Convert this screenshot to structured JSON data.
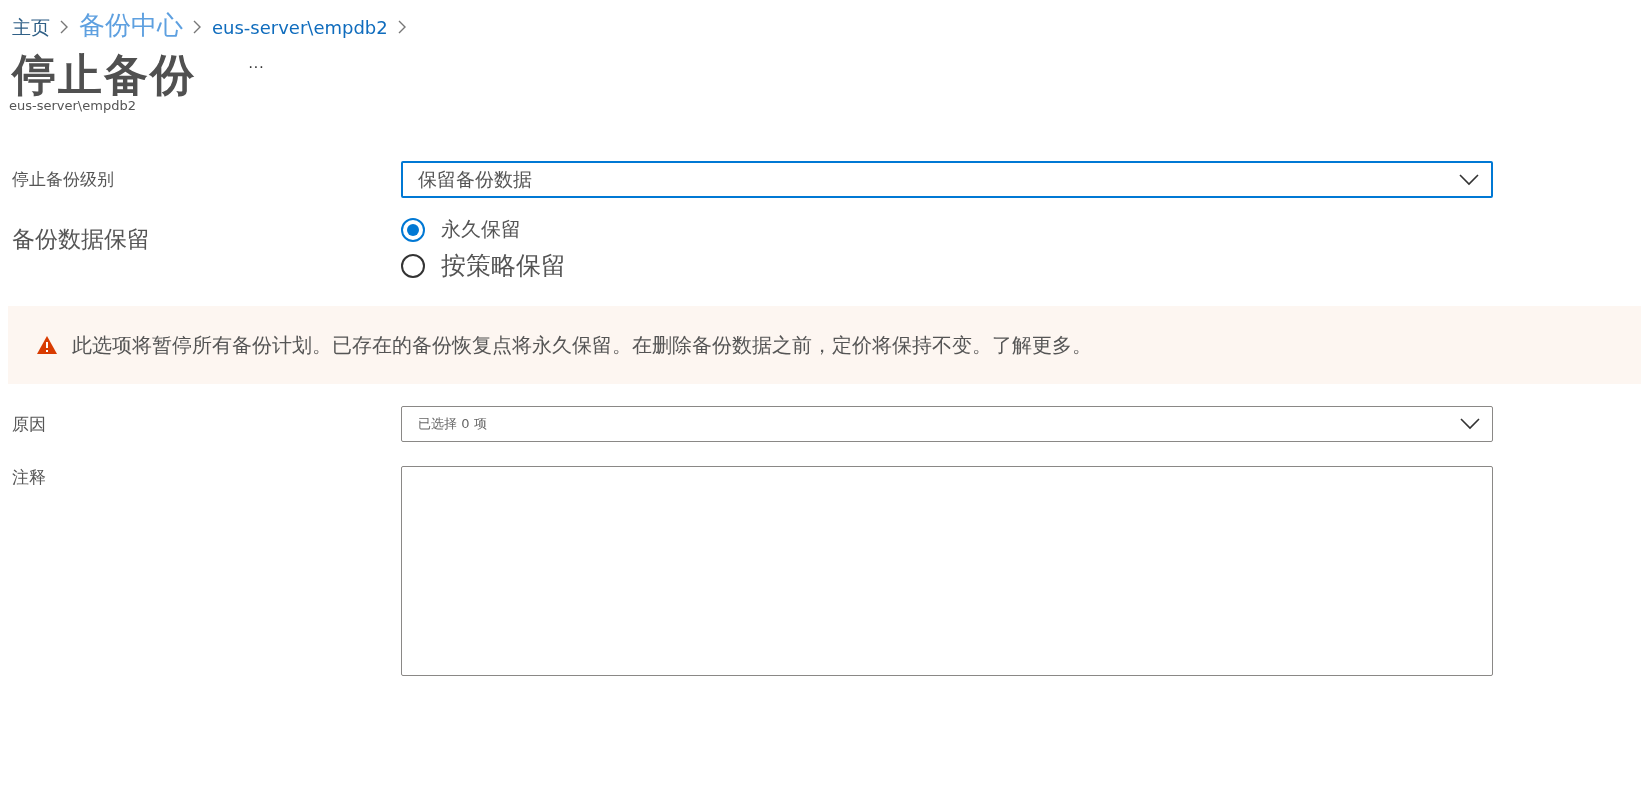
{
  "breadcrumb": [
    {
      "label": "主页",
      "kind": "home"
    },
    {
      "label": "备份中心",
      "kind": "large"
    },
    {
      "label": "eus-server\\empdb2",
      "kind": "link"
    }
  ],
  "header": {
    "title": "停止备份",
    "more": "···",
    "subtitle": "eus-server\\empdb2"
  },
  "stop_level": {
    "label": "停止备份级别",
    "value": "保留备份数据",
    "focused": true
  },
  "retention": {
    "label": "备份数据保留",
    "options": [
      {
        "label": "永久保留",
        "selected": true
      },
      {
        "label": "按策略保留",
        "selected": false
      }
    ]
  },
  "warning": {
    "text": "此选项将暂停所有备份计划。已存在的备份恢复点将永久保留。在删除备份数据之前，定价将保持不变。了解更多。"
  },
  "reason": {
    "label": "原因",
    "value": "已选择 0 项",
    "focused": false
  },
  "comments": {
    "label": "注释"
  }
}
